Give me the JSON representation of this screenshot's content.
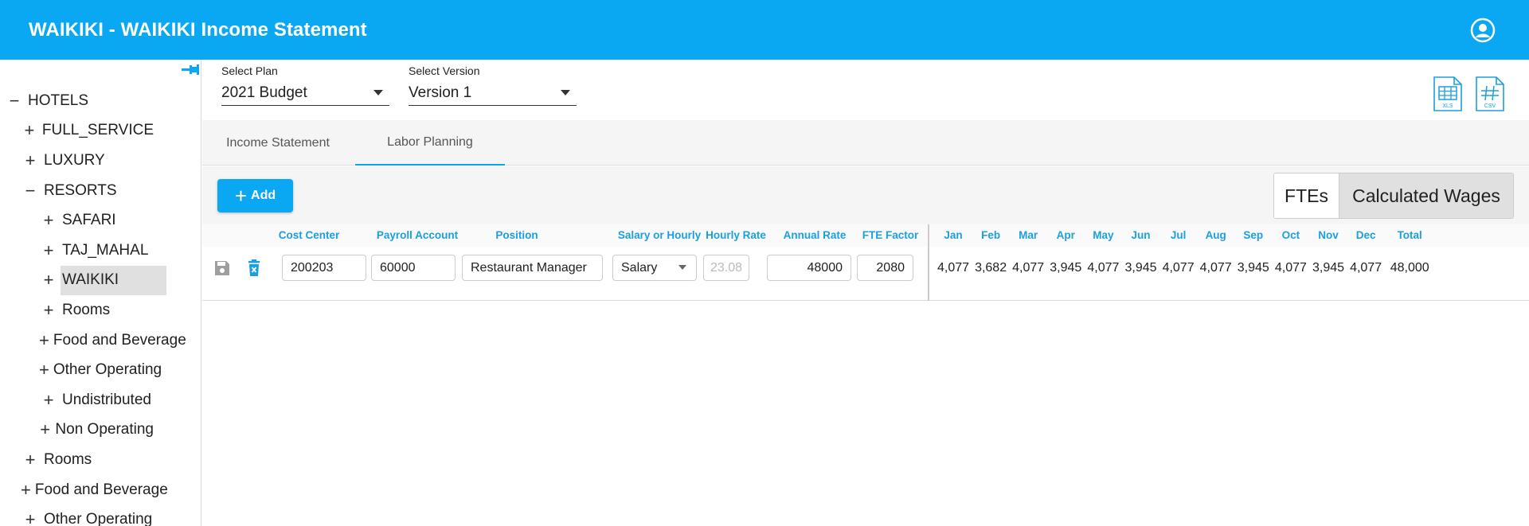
{
  "header": {
    "title": "WAIKIKI - WAIKIKI Income Statement",
    "account_icon": "account-circle-icon"
  },
  "sidebar": {
    "pin_icon": "pin-icon",
    "items": [
      {
        "label": "HOTELS",
        "toggle": "−",
        "level": 0
      },
      {
        "label": "FULL_SERVICE",
        "toggle": "+",
        "level": 1
      },
      {
        "label": "LUXURY",
        "toggle": "+",
        "level": 1
      },
      {
        "label": "RESORTS",
        "toggle": "−",
        "level": 1
      },
      {
        "label": "SAFARI",
        "toggle": "+",
        "level": 2
      },
      {
        "label": "TAJ_MAHAL",
        "toggle": "+",
        "level": 2
      },
      {
        "label": "WAIKIKI",
        "toggle": "+",
        "level": 2,
        "selected": true
      },
      {
        "label": "Rooms",
        "toggle": "+",
        "level": 2
      },
      {
        "label": "Food and Beverage",
        "toggle": "+",
        "level": 2
      },
      {
        "label": "Other Operating",
        "toggle": "+",
        "level": 2
      },
      {
        "label": "Undistributed",
        "toggle": "+",
        "level": 2
      },
      {
        "label": "Non Operating",
        "toggle": "+",
        "level": 2
      },
      {
        "label": "Rooms",
        "toggle": "+",
        "level": 1
      },
      {
        "label": "Food and Beverage",
        "toggle": "+",
        "level": 1
      },
      {
        "label": "Other Operating",
        "toggle": "+",
        "level": 1
      }
    ]
  },
  "selectors": {
    "plan": {
      "label": "Select Plan",
      "value": "2021 Budget"
    },
    "version": {
      "label": "Select Version",
      "value": "Version 1"
    }
  },
  "exports": {
    "xls": "XLS",
    "csv": "CSV"
  },
  "tabs": [
    {
      "label": "Income Statement",
      "active": false
    },
    {
      "label": "Labor Planning",
      "active": true
    }
  ],
  "toolbar": {
    "add_label": "Add",
    "fte_label": "FTEs",
    "wages_label": "Calculated Wages"
  },
  "grid": {
    "headers": {
      "cost_center": "Cost Center",
      "payroll_account": "Payroll Account",
      "position": "Position",
      "salary_or_hourly": "Salary or Hourly",
      "hourly_rate": "Hourly Rate",
      "annual_rate": "Annual Rate",
      "fte_factor": "FTE Factor",
      "months": [
        "Jan",
        "Feb",
        "Mar",
        "Apr",
        "May",
        "Jun",
        "Jul",
        "Aug",
        "Sep",
        "Oct",
        "Nov",
        "Dec",
        "Total"
      ]
    },
    "row": {
      "cost_center": "200203",
      "payroll_account": "60000",
      "position": "Restaurant Manager",
      "salary_or_hourly": "Salary",
      "hourly_rate": "23.08",
      "annual_rate": "48000",
      "fte_factor": "2080",
      "months": [
        "4,077",
        "3,682",
        "4,077",
        "3,945",
        "4,077",
        "3,945",
        "4,077",
        "4,077",
        "3,945",
        "4,077",
        "3,945",
        "4,077",
        "48,000"
      ]
    }
  },
  "colors": {
    "primary": "#0aa7f2",
    "header_text": "#1a9fe0",
    "delete": "#1a9fe0"
  }
}
